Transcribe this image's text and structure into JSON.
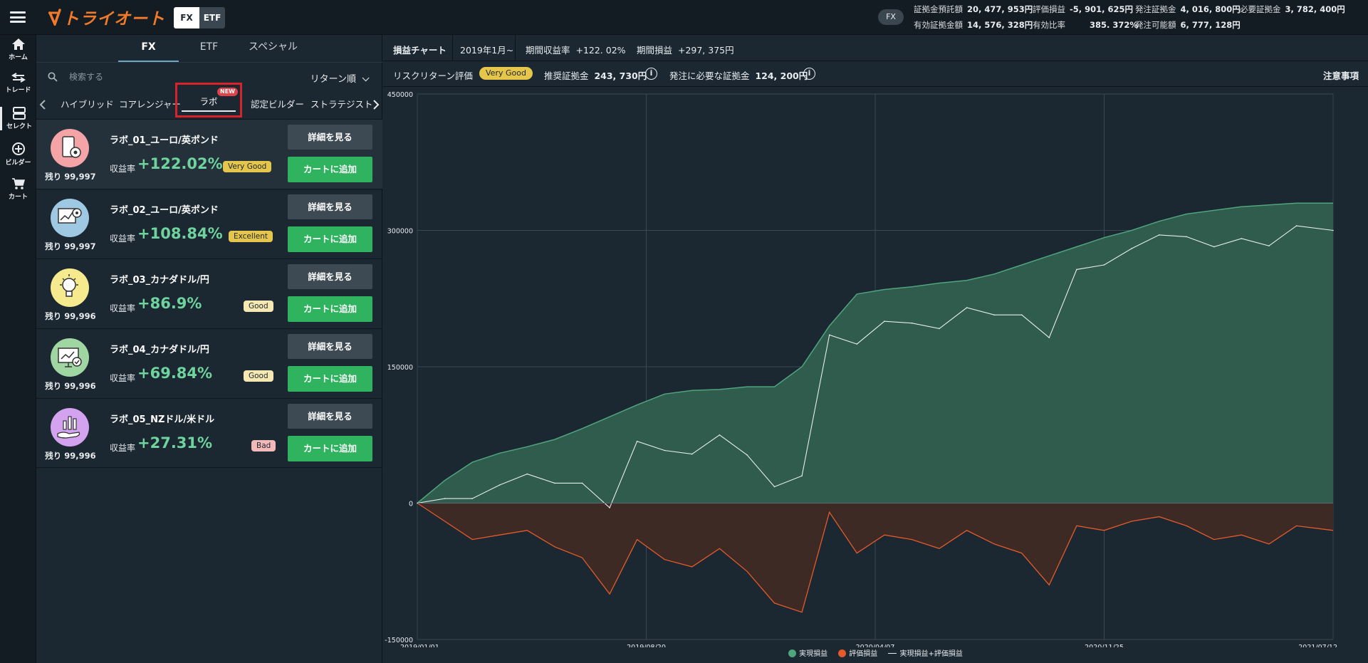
{
  "app": {
    "logo_text": "トライオート",
    "mode_tabs": [
      "FX",
      "ETF"
    ],
    "active_mode": "FX"
  },
  "account": {
    "fx_pill": "FX",
    "row1": [
      {
        "label": "証拠金預託額",
        "value": "20, 477, 953円"
      },
      {
        "label": "評価損益",
        "value": "-5, 901, 625円"
      },
      {
        "label": "発注証拠金",
        "value": "4, 016, 800円"
      },
      {
        "label": "必要証拠金",
        "value": "3, 782, 400円"
      }
    ],
    "row2": [
      {
        "label": "有効証拠金額",
        "value": "14, 576, 328円"
      },
      {
        "label": "有効比率",
        "value": "385. 372%"
      },
      {
        "label": "発注可能額",
        "value": "6, 777, 128円"
      }
    ]
  },
  "leftnav": [
    {
      "label": "ホーム",
      "icon": "home-icon"
    },
    {
      "label": "トレード",
      "icon": "trade-icon"
    },
    {
      "label": "セレクト",
      "icon": "select-icon"
    },
    {
      "label": "ビルダー",
      "icon": "builder-icon"
    },
    {
      "label": "カート",
      "icon": "cart-icon"
    }
  ],
  "panel": {
    "tabs": [
      "FX",
      "ETF",
      "スペシャル"
    ],
    "active_tab": "FX",
    "search_placeholder": "検索する",
    "sort_label": "リターン順",
    "categories": [
      "ハイブリッド",
      "コアレンジャー",
      "ラボ",
      "認定ビルダー",
      "ストラテジスト"
    ],
    "active_category": "ラボ",
    "new_badge": "NEW",
    "detail_label": "詳細を見る",
    "cart_label": "カートに追加",
    "return_label": "収益率",
    "items": [
      {
        "name": "ラボ_01_ユーロ/英ポンド",
        "remaining": "残り 99,997",
        "return": "+122.02%",
        "rating": "Very Good",
        "badge_color": "#e6c64a",
        "icon_bg": "#f4a3a6",
        "icon": "phone-gear-icon"
      },
      {
        "name": "ラボ_02_ユーロ/英ポンド",
        "remaining": "残り 99,997",
        "return": "+108.84%",
        "rating": "Excellent",
        "badge_color": "#e6c64a",
        "icon_bg": "#9fc9e3",
        "icon": "chart-gear-icon"
      },
      {
        "name": "ラボ_03_カナダドル/円",
        "remaining": "残り 99,996",
        "return": "+86.9%",
        "rating": "Good",
        "badge_color": "#f6e8b2",
        "icon_bg": "#f6ea8e",
        "icon": "bulb-gear-icon"
      },
      {
        "name": "ラボ_04_カナダドル/円",
        "remaining": "残り 99,996",
        "return": "+69.84%",
        "rating": "Good",
        "badge_color": "#f6e8b2",
        "icon_bg": "#9fd6a2",
        "icon": "monitor-check-icon"
      },
      {
        "name": "ラボ_05_NZドル/米ドル",
        "remaining": "残り 99,996",
        "return": "+27.31%",
        "rating": "Bad",
        "badge_color": "#f3b8b8",
        "icon_bg": "#d4a3ef",
        "icon": "hand-chart-icon"
      }
    ]
  },
  "main": {
    "chart_tab": "損益チャート",
    "period": "2019年1月~",
    "period_return_label": "期間収益率",
    "period_return_value": "+122. 02%",
    "period_pnl_label": "期間損益",
    "period_pnl_value": "+297, 375円",
    "risk_label": "リスクリターン評価",
    "risk_rating": "Very Good",
    "recommended_label": "推奨証拠金",
    "recommended_value": "243, 730円",
    "required_label": "発注に必要な証拠金",
    "required_value": "124, 200円",
    "notes_link": "注意事項",
    "info_glyph": "i"
  },
  "chart_data": {
    "type": "area",
    "x_ticks": [
      "2019/01/01",
      "2019/08/20",
      "2020/04/07",
      "2020/11/25",
      "2021/07/12"
    ],
    "y_ticks": [
      "450000",
      "300000",
      "150000",
      "0",
      "-150000"
    ],
    "ylim": [
      -150000,
      450000
    ],
    "legend": [
      "実現損益",
      "評価損益",
      "実現損益+評価損益"
    ],
    "colors": {
      "realized": "#4fa57e",
      "realized_fill": "#2f5c4c",
      "unrealized": "#e45a2a",
      "unrealized_fill": "#3d2a25",
      "total": "#e8ecef"
    },
    "x": [
      0,
      0.03,
      0.06,
      0.09,
      0.12,
      0.15,
      0.18,
      0.21,
      0.24,
      0.27,
      0.3,
      0.33,
      0.36,
      0.39,
      0.42,
      0.45,
      0.48,
      0.51,
      0.54,
      0.57,
      0.6,
      0.63,
      0.66,
      0.69,
      0.72,
      0.75,
      0.78,
      0.81,
      0.84,
      0.87,
      0.9,
      0.93,
      0.96,
      1.0
    ],
    "series": [
      {
        "name": "実現損益",
        "values": [
          0,
          25000,
          45000,
          55000,
          62000,
          70000,
          82000,
          95000,
          108000,
          120000,
          124000,
          125000,
          128000,
          128000,
          150000,
          195000,
          230000,
          235000,
          238000,
          242000,
          245000,
          252000,
          262000,
          272000,
          282000,
          292000,
          300000,
          310000,
          318000,
          322000,
          326000,
          328000,
          330000,
          330000
        ]
      },
      {
        "name": "評価損益",
        "values": [
          0,
          -20000,
          -40000,
          -35000,
          -30000,
          -48000,
          -60000,
          -100000,
          -40000,
          -62000,
          -70000,
          -50000,
          -75000,
          -110000,
          -120000,
          -10000,
          -55000,
          -35000,
          -40000,
          -50000,
          -30000,
          -45000,
          -55000,
          -90000,
          -25000,
          -30000,
          -20000,
          -15000,
          -25000,
          -40000,
          -35000,
          -45000,
          -25000,
          -30000
        ]
      },
      {
        "name": "実現損益+評価損益",
        "values": [
          0,
          5000,
          5000,
          20000,
          32000,
          22000,
          22000,
          -5000,
          68000,
          58000,
          54000,
          75000,
          53000,
          18000,
          30000,
          185000,
          175000,
          200000,
          198000,
          192000,
          215000,
          207000,
          207000,
          182000,
          257000,
          262000,
          280000,
          295000,
          293000,
          282000,
          291000,
          283000,
          305000,
          300000
        ]
      }
    ]
  }
}
